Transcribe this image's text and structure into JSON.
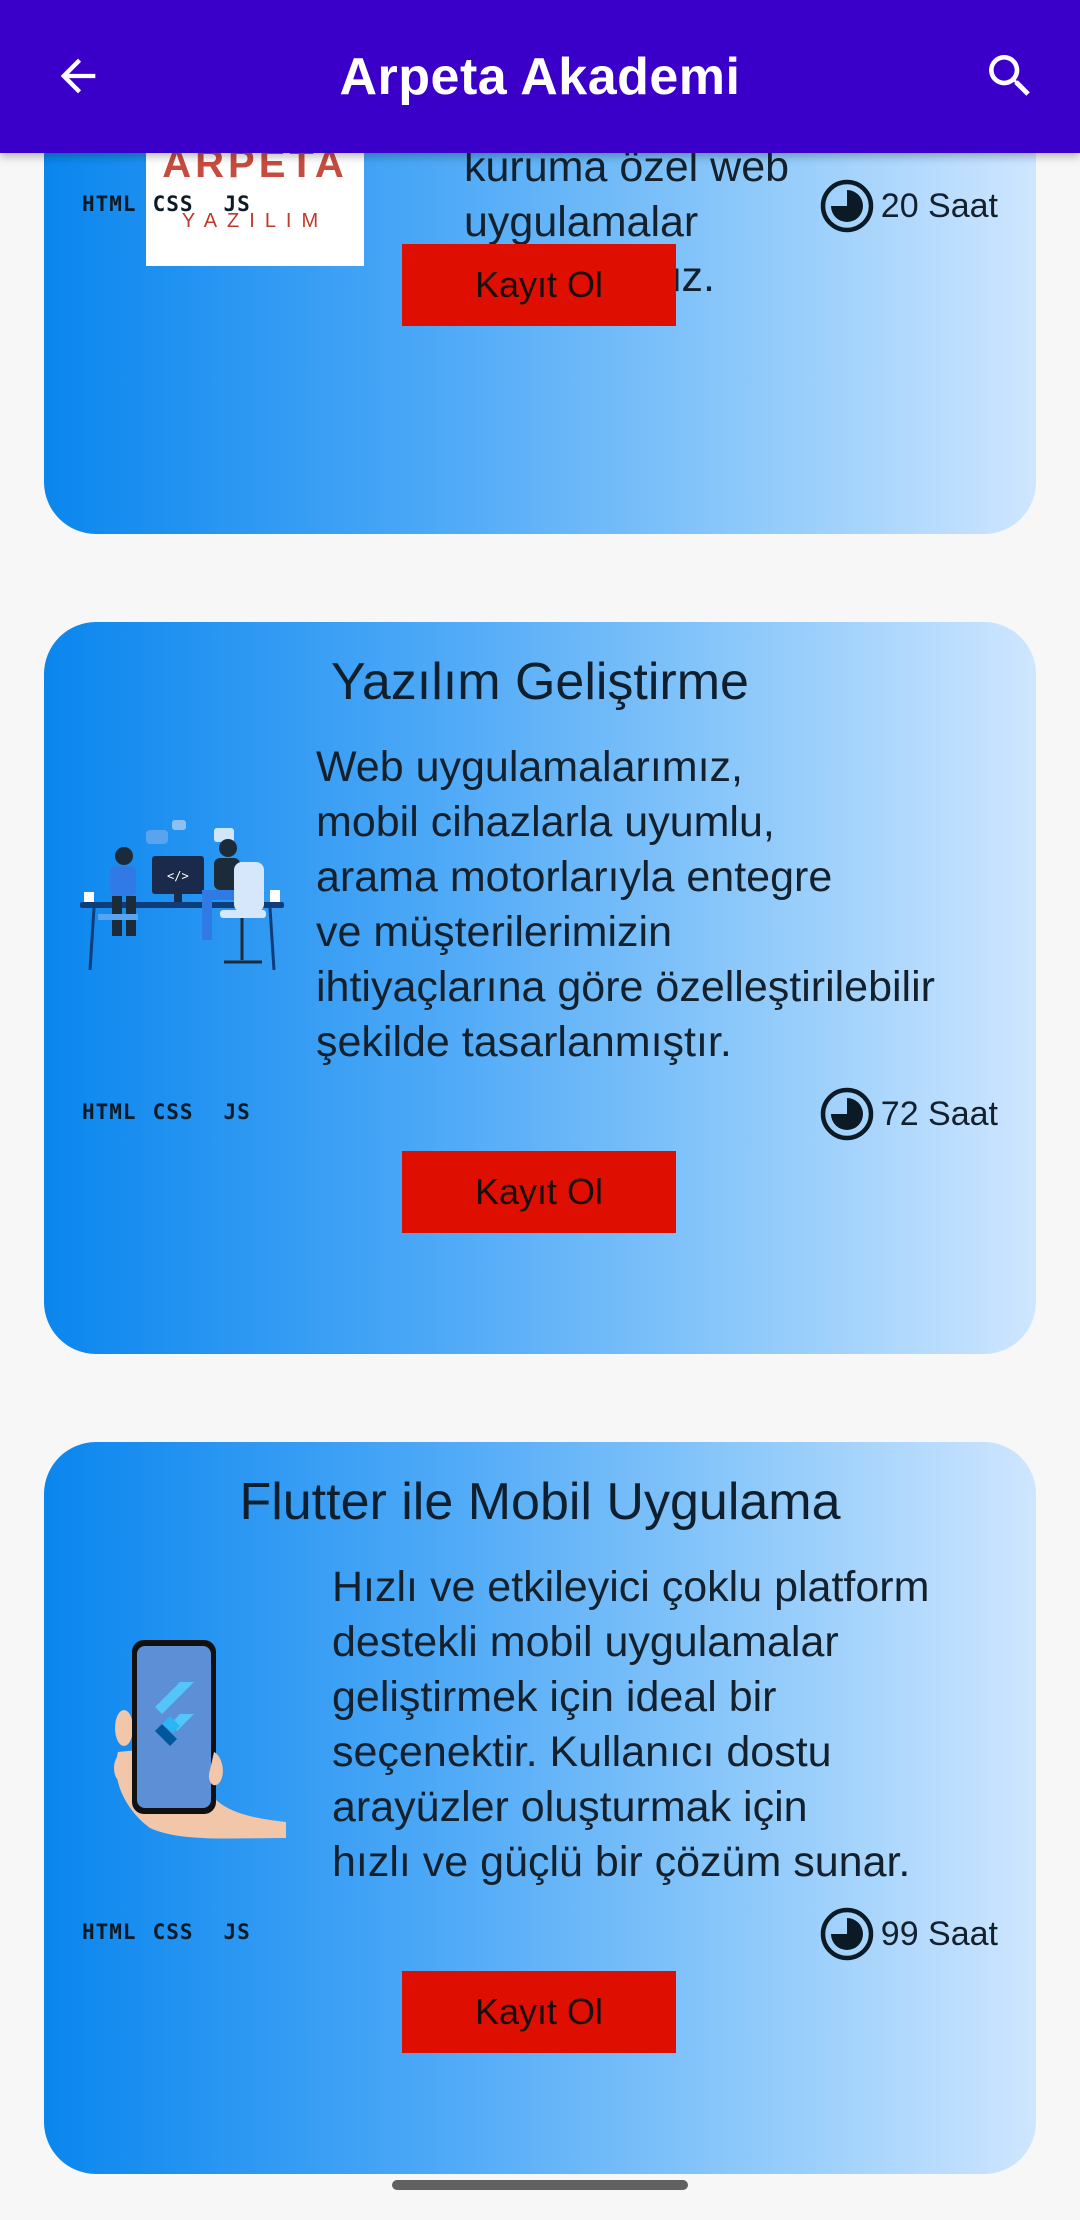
{
  "appbar": {
    "title": "Arpeta Akademi",
    "back_icon": "arrow-left-icon",
    "search_icon": "search-icon",
    "color": "#3a00c9"
  },
  "courses": [
    {
      "title": "",
      "description_lines": [
        "kuruma özel web",
        "uygulamalar",
        "geliştiriyoruz."
      ],
      "logo_text": "YAZILIM",
      "tech": [
        "HTML",
        "CSS",
        "JS"
      ],
      "hours": "20 Saat",
      "button": "Kayıt Ol"
    },
    {
      "title": "Yazılım Geliştirme",
      "description_lines": [
        "Web uygulamalarımız,",
        "mobil cihazlarla uyumlu,",
        "arama motorlarıyla entegre",
        "ve müşterilerimizin",
        "ihtiyaçlarına göre özelleştirilebilir",
        "şekilde tasarlanmıştır."
      ],
      "tech": [
        "HTML",
        "CSS",
        "JS"
      ],
      "hours": "72 Saat",
      "button": "Kayıt Ol"
    },
    {
      "title": "Flutter ile Mobil Uygulama",
      "description_lines": [
        "Hızlı ve etkileyici çoklu platform",
        "destekli mobil uygulamalar",
        "geliştirmek için ideal bir",
        "seçenektir. Kullanıcı dostu",
        "arayüzler oluşturmak için",
        "hızlı ve güçlü bir çözüm sunar."
      ],
      "tech": [
        "HTML",
        "CSS",
        "JS"
      ],
      "hours": "99 Saat",
      "button": "Kayıt Ol"
    }
  ],
  "colors": {
    "button": "#de0f00",
    "card_gradient_start": "#0a86ee",
    "card_gradient_end": "#cfe6ff"
  }
}
